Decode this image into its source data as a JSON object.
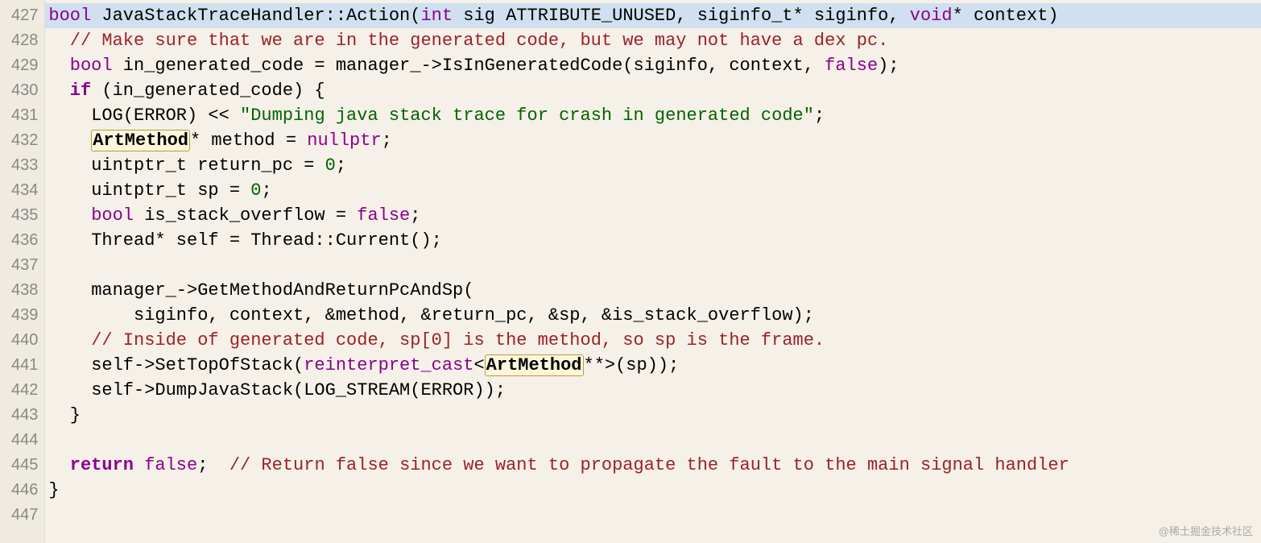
{
  "gutter": {
    "start": 427,
    "end": 447
  },
  "highlighted_line": 427,
  "lines": {
    "427": {
      "tokens": [
        {
          "t": "bool",
          "cls": "kw-type"
        },
        {
          "t": " JavaStackTraceHandler::Action(",
          "cls": "identifier"
        },
        {
          "t": "int",
          "cls": "kw-type"
        },
        {
          "t": " sig ATTRIBUTE_UNUSED, siginfo_t* siginfo, ",
          "cls": "identifier"
        },
        {
          "t": "void",
          "cls": "kw-type"
        },
        {
          "t": "* context)",
          "cls": "identifier"
        }
      ]
    },
    "428": {
      "indent": "  ",
      "tokens": [
        {
          "t": "// Make sure that we are in the generated code, but we may not have a dex pc.",
          "cls": "comment"
        }
      ]
    },
    "429": {
      "indent": "  ",
      "tokens": [
        {
          "t": "bool",
          "cls": "kw-type"
        },
        {
          "t": " in_generated_code = manager_->IsInGeneratedCode(siginfo, context, ",
          "cls": "identifier"
        },
        {
          "t": "false",
          "cls": "kw-bool"
        },
        {
          "t": ");",
          "cls": "identifier"
        }
      ]
    },
    "430": {
      "indent": "  ",
      "tokens": [
        {
          "t": "if",
          "cls": "kw-keyword"
        },
        {
          "t": " (in_generated_code) {",
          "cls": "identifier"
        }
      ]
    },
    "431": {
      "indent": "    ",
      "tokens": [
        {
          "t": "LOG(ERROR) << ",
          "cls": "identifier"
        },
        {
          "t": "\"Dumping java stack trace for crash in generated code\"",
          "cls": "string"
        },
        {
          "t": ";",
          "cls": "identifier"
        }
      ]
    },
    "432": {
      "indent": "    ",
      "tokens": [
        {
          "t": "ArtMethod",
          "cls": "highlighted-token"
        },
        {
          "t": "* method = ",
          "cls": "identifier"
        },
        {
          "t": "nullptr",
          "cls": "kw-type"
        },
        {
          "t": ";",
          "cls": "identifier"
        }
      ]
    },
    "433": {
      "indent": "    ",
      "tokens": [
        {
          "t": "uintptr_t return_pc = ",
          "cls": "identifier"
        },
        {
          "t": "0",
          "cls": "number"
        },
        {
          "t": ";",
          "cls": "identifier"
        }
      ]
    },
    "434": {
      "indent": "    ",
      "tokens": [
        {
          "t": "uintptr_t sp = ",
          "cls": "identifier"
        },
        {
          "t": "0",
          "cls": "number"
        },
        {
          "t": ";",
          "cls": "identifier"
        }
      ]
    },
    "435": {
      "indent": "    ",
      "tokens": [
        {
          "t": "bool",
          "cls": "kw-type"
        },
        {
          "t": " is_stack_overflow = ",
          "cls": "identifier"
        },
        {
          "t": "false",
          "cls": "kw-bool"
        },
        {
          "t": ";",
          "cls": "identifier"
        }
      ]
    },
    "436": {
      "indent": "    ",
      "tokens": [
        {
          "t": "Thread* self = Thread::Current();",
          "cls": "identifier"
        }
      ]
    },
    "437": {
      "indent": "",
      "tokens": []
    },
    "438": {
      "indent": "    ",
      "tokens": [
        {
          "t": "manager_->GetMethodAndReturnPcAndSp(",
          "cls": "identifier"
        }
      ]
    },
    "439": {
      "indent": "        ",
      "tokens": [
        {
          "t": "siginfo, context, &method, &return_pc, &sp, &is_stack_overflow);",
          "cls": "identifier"
        }
      ]
    },
    "440": {
      "indent": "    ",
      "tokens": [
        {
          "t": "// Inside of generated code, sp[0] is the method, so sp is the frame.",
          "cls": "comment"
        }
      ]
    },
    "441": {
      "indent": "    ",
      "tokens": [
        {
          "t": "self->SetTopOfStack(",
          "cls": "identifier"
        },
        {
          "t": "reinterpret_cast",
          "cls": "kw-type"
        },
        {
          "t": "<",
          "cls": "identifier"
        },
        {
          "t": "ArtMethod",
          "cls": "highlighted-token"
        },
        {
          "t": "**>(sp));",
          "cls": "identifier"
        }
      ]
    },
    "442": {
      "indent": "    ",
      "tokens": [
        {
          "t": "self->DumpJavaStack(LOG_STREAM(ERROR));",
          "cls": "identifier"
        }
      ]
    },
    "443": {
      "indent": "  ",
      "tokens": [
        {
          "t": "}",
          "cls": "identifier"
        }
      ]
    },
    "444": {
      "indent": "",
      "tokens": []
    },
    "445": {
      "indent": "  ",
      "tokens": [
        {
          "t": "return",
          "cls": "kw-keyword"
        },
        {
          "t": " ",
          "cls": "identifier"
        },
        {
          "t": "false",
          "cls": "kw-bool"
        },
        {
          "t": ";  ",
          "cls": "identifier"
        },
        {
          "t": "// Return false since we want to propagate the fault to the main signal handler",
          "cls": "comment"
        }
      ]
    },
    "446": {
      "indent": "",
      "tokens": [
        {
          "t": "}",
          "cls": "identifier"
        }
      ]
    },
    "447": {
      "indent": "",
      "tokens": []
    }
  },
  "watermark": "@稀土掘金技术社区"
}
